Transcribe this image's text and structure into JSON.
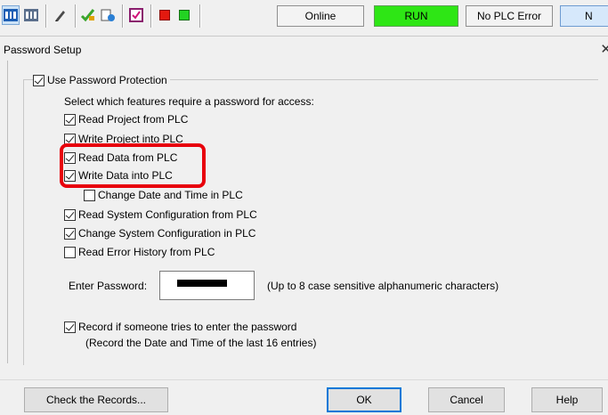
{
  "toolbar": {
    "icons": [
      "monitor-start-icon",
      "monitor-stop-icon",
      "edit-pencil-icon",
      "write-check-icon",
      "diagnostics-icon",
      "checklist-icon",
      "stop-square-icon",
      "run-square-icon"
    ],
    "status_online": "Online",
    "status_run": "RUN",
    "status_error": "No PLC Error",
    "status_partial": "N",
    "colors": {
      "run_bg": "#2ee615",
      "stop": "#e3190f",
      "run": "#22d322"
    }
  },
  "dialog": {
    "title": "Password Setup",
    "use_protection_label": "Use Password Protection",
    "use_protection_checked": true,
    "instruction": "Select which features require a password for access:",
    "features": [
      {
        "label": "Read Project from PLC",
        "checked": true
      },
      {
        "label": "Write Project into PLC",
        "checked": true
      },
      {
        "label": "Read Data from PLC",
        "checked": true
      },
      {
        "label": "Write Data into PLC",
        "checked": true
      },
      {
        "label": "Change Date and Time in PLC",
        "checked": false
      },
      {
        "label": "Read System Configuration from PLC",
        "checked": true
      },
      {
        "label": "Change System Configuration in PLC",
        "checked": true
      },
      {
        "label": "Read Error History from PLC",
        "checked": false
      }
    ],
    "password_label": "Enter Password:",
    "password_hint": "(Up to 8 case sensitive alphanumeric characters)",
    "record_label": "Record if someone tries to enter the password",
    "record_checked": true,
    "record_note": "(Record the Date and Time of the last 16 entries)",
    "buttons": {
      "check_records": "Check the Records...",
      "ok": "OK",
      "cancel": "Cancel",
      "help": "Help"
    },
    "highlight_color": "#e8000b"
  }
}
